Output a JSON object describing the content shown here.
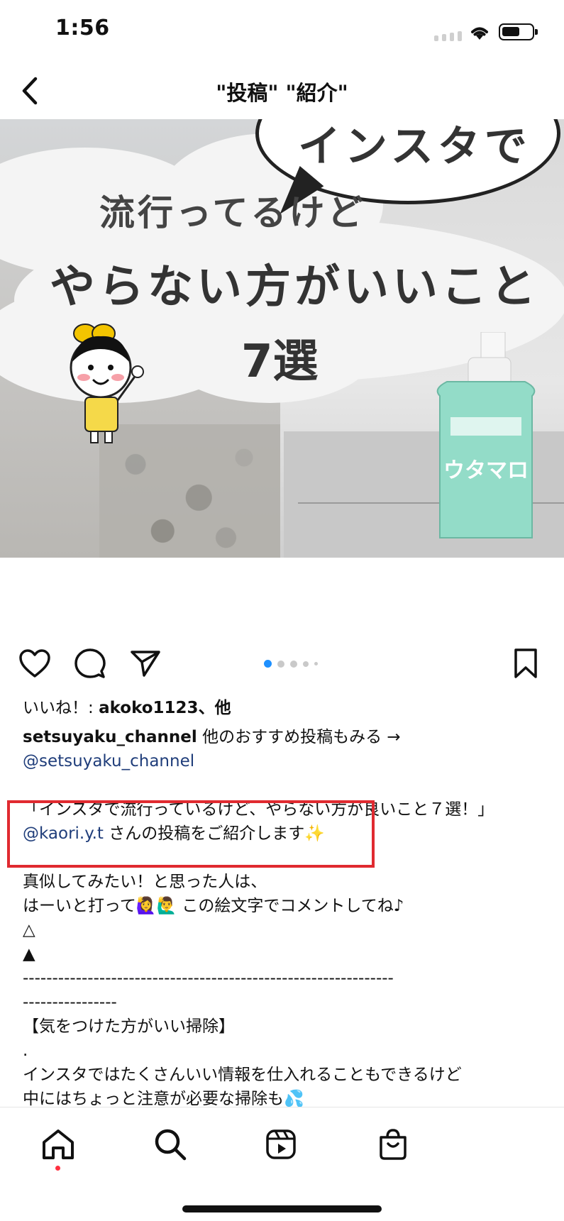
{
  "status_bar": {
    "time": "1:56",
    "battery_level": 0.6
  },
  "header": {
    "title": "\"投稿\" \"紹介\""
  },
  "post_image": {
    "bubble_text": "インスタで",
    "line1": "流行ってるけど",
    "line2": "やらない方がいいこと",
    "line3": "7選",
    "bottle_label": "ウタマロ"
  },
  "carousel": {
    "count": 5,
    "active_index": 0
  },
  "likes": {
    "prefix": "いいね！: ",
    "user": "akoko1123",
    "suffix": "、他"
  },
  "caption": {
    "username": "setsuyaku_channel",
    "line1_text": " 他のおすすめ投稿もみる →",
    "line2_mention": "@setsuyaku_channel",
    "line3": "「インスタで流行っているけど、やらない方が良いこと７選！」",
    "line4_mention": "@kaori.y.t",
    "line4_text": " さんの投稿をご紹介します✨",
    "line5": "真似してみたい！と思った人は、",
    "line6": "はーいと打って🙋‍♀️🙋‍♂️ この絵文字でコメントしてね♪",
    "line7": "△",
    "line8": "▲",
    "line9": "---------------------------------------------------------------",
    "line10": "----------------",
    "line11": "【気をつけた方がいい掃除】",
    "line12": ".",
    "line13": "インスタではたくさんいい情報を仕入れることもできるけど",
    "line14": "中にはちょっと注意が必要な掃除も💦"
  },
  "icons": {
    "back": "chevron-left-icon",
    "like": "heart-icon",
    "comment": "comment-icon",
    "share": "send-icon",
    "save": "bookmark-icon",
    "home": "home-icon",
    "search": "search-icon",
    "reels": "reels-icon",
    "shop": "shop-icon"
  },
  "colors": {
    "accent": "#1f3d7a",
    "highlight": "#e02a30",
    "active_dot": "#1e90ff",
    "notification": "#ff3040"
  }
}
